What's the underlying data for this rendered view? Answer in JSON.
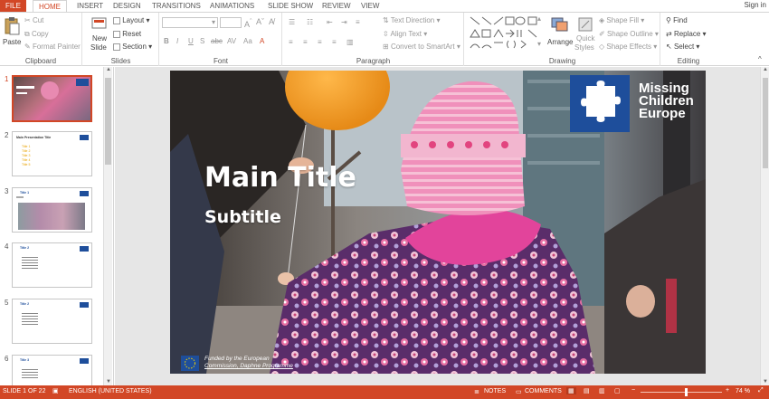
{
  "tabs": [
    "FILE",
    "HOME",
    "INSERT",
    "DESIGN",
    "TRANSITIONS",
    "ANIMATIONS",
    "SLIDE SHOW",
    "REVIEW",
    "VIEW"
  ],
  "active_tab": "HOME",
  "sign_in": "Sign in",
  "clipboard": {
    "paste": "Paste",
    "cut": "Cut",
    "copy": "Copy",
    "format_painter": "Format Painter",
    "label": "Clipboard"
  },
  "slides": {
    "new_slide": "New",
    "new_slide2": "Slide",
    "layout": "Layout",
    "reset": "Reset",
    "section": "Section",
    "label": "Slides"
  },
  "font": {
    "label": "Font"
  },
  "paragraph": {
    "text_direction": "Text Direction",
    "align_text": "Align Text",
    "convert": "Convert to SmartArt",
    "label": "Paragraph"
  },
  "drawing": {
    "arrange": "Arrange",
    "quick": "Quick",
    "styles": "Styles",
    "shape_fill": "Shape Fill",
    "shape_outline": "Shape Outline",
    "shape_effects": "Shape Effects",
    "label": "Drawing"
  },
  "editing": {
    "find": "Find",
    "replace": "Replace",
    "select": "Select",
    "label": "Editing"
  },
  "thumbnails": [
    {
      "num": "1"
    },
    {
      "num": "2",
      "title": "Main Presentation Title",
      "bullets": [
        "Title 1",
        "Title 2",
        "Title 3",
        "Title 4",
        "Title 5"
      ]
    },
    {
      "num": "3",
      "title": "Title 1"
    },
    {
      "num": "4",
      "title": "Title 2"
    },
    {
      "num": "5",
      "title": "Title 2"
    },
    {
      "num": "6",
      "title": "Title 3"
    }
  ],
  "slide": {
    "title": "Main Title",
    "subtitle": "Subtitle",
    "logo_line1": "Missing",
    "logo_line2": "Children",
    "logo_line3": "Europe",
    "funding_line1": "Funded by the European",
    "funding_line2": "Commission, Daphne Programme"
  },
  "status": {
    "slide": "SLIDE 1 OF 22",
    "language": "ENGLISH (UNITED STATES)",
    "notes": "NOTES",
    "comments": "COMMENTS",
    "zoom": "74 %"
  },
  "colors": {
    "accent": "#d24726",
    "logo_blue": "#1e4e9b"
  }
}
